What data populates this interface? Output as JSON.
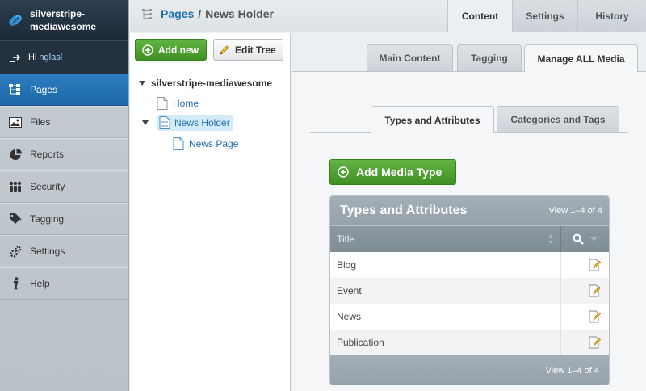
{
  "brand": {
    "title": "silverstripe-mediawesome"
  },
  "user": {
    "greeting": "Hi",
    "name": "nglasl"
  },
  "sidebar": {
    "items": [
      {
        "label": "Pages",
        "icon": "pages-icon"
      },
      {
        "label": "Files",
        "icon": "files-icon"
      },
      {
        "label": "Reports",
        "icon": "reports-icon"
      },
      {
        "label": "Security",
        "icon": "security-icon"
      },
      {
        "label": "Tagging",
        "icon": "tagging-icon"
      },
      {
        "label": "Settings",
        "icon": "settings-icon"
      },
      {
        "label": "Help",
        "icon": "help-icon"
      }
    ]
  },
  "header": {
    "breadcrumb": {
      "link": "Pages",
      "separator": "/",
      "current": "News Holder"
    },
    "tabs": [
      {
        "label": "Content"
      },
      {
        "label": "Settings"
      },
      {
        "label": "History"
      }
    ]
  },
  "tree": {
    "add_new": "Add new",
    "edit_tree": "Edit Tree",
    "root": "silverstripe-mediawesome",
    "nodes": [
      {
        "label": "Home"
      },
      {
        "label": "News Holder"
      },
      {
        "label": "News Page"
      }
    ]
  },
  "content": {
    "tabs": [
      {
        "label": "Main Content"
      },
      {
        "label": "Tagging"
      },
      {
        "label": "Manage ALL Media"
      }
    ],
    "subtabs": [
      {
        "label": "Types and Attributes"
      },
      {
        "label": "Categories and Tags"
      }
    ],
    "add_button": "Add Media Type"
  },
  "grid": {
    "title": "Types and Attributes",
    "view_top": "View 1–4 of 4",
    "view_bottom": "View 1–4 of 4",
    "column_title": "Title",
    "rows": [
      {
        "title": "Blog"
      },
      {
        "title": "Event"
      },
      {
        "title": "News"
      },
      {
        "title": "Publication"
      }
    ]
  },
  "colors": {
    "active_nav": "#1d67a6",
    "link": "#1f6fb0",
    "green_button": "#4ca230"
  }
}
